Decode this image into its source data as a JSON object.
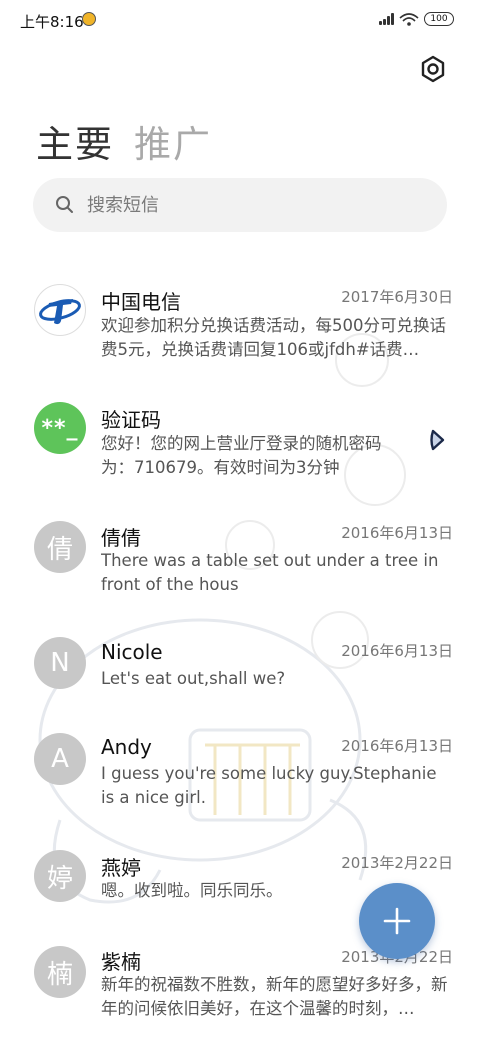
{
  "status_bar": {
    "time": "上午8:16",
    "battery": "100"
  },
  "tabs": {
    "primary": "主要",
    "promo": "推广"
  },
  "search": {
    "placeholder": "搜索短信"
  },
  "conversations": [
    {
      "name": "中国电信",
      "date": "2017年6月30日",
      "preview": "欢迎参加积分兑换话费活动，每500分可兑换话费5元，兑换话费请回复106或jfdh#话费…",
      "avatar": ""
    },
    {
      "name": "验证码",
      "date": "",
      "preview": "您好！您的网上营业厅登录的随机密码为：710679。有效时间为3分钟",
      "avatar": "**_"
    },
    {
      "name": "倩倩",
      "date": "2016年6月13日",
      "preview": "There was a table set out under a tree in front of the hous",
      "avatar": "倩"
    },
    {
      "name": "Nicole",
      "date": "2016年6月13日",
      "preview": "Let's eat out,shall we?",
      "avatar": "N"
    },
    {
      "name": "Andy",
      "date": "2016年6月13日",
      "preview": "I guess you're some lucky guy.Stephanie is a nice girl.",
      "avatar": "A"
    },
    {
      "name": "燕婷",
      "date": "2013年2月22日",
      "preview": "嗯。收到啦。同乐同乐。",
      "avatar": "婷"
    },
    {
      "name": "紫楠",
      "date": "2013年2月22日",
      "preview": "新年的祝福数不胜数，新年的愿望好多好多，新年的问候依旧美好，在这个温馨的时刻，…",
      "avatar": "楠"
    }
  ],
  "colors": {
    "accent": "#5b8fc9",
    "green_avatar": "#5ec45a",
    "grey_avatar": "#c8c8c8"
  }
}
